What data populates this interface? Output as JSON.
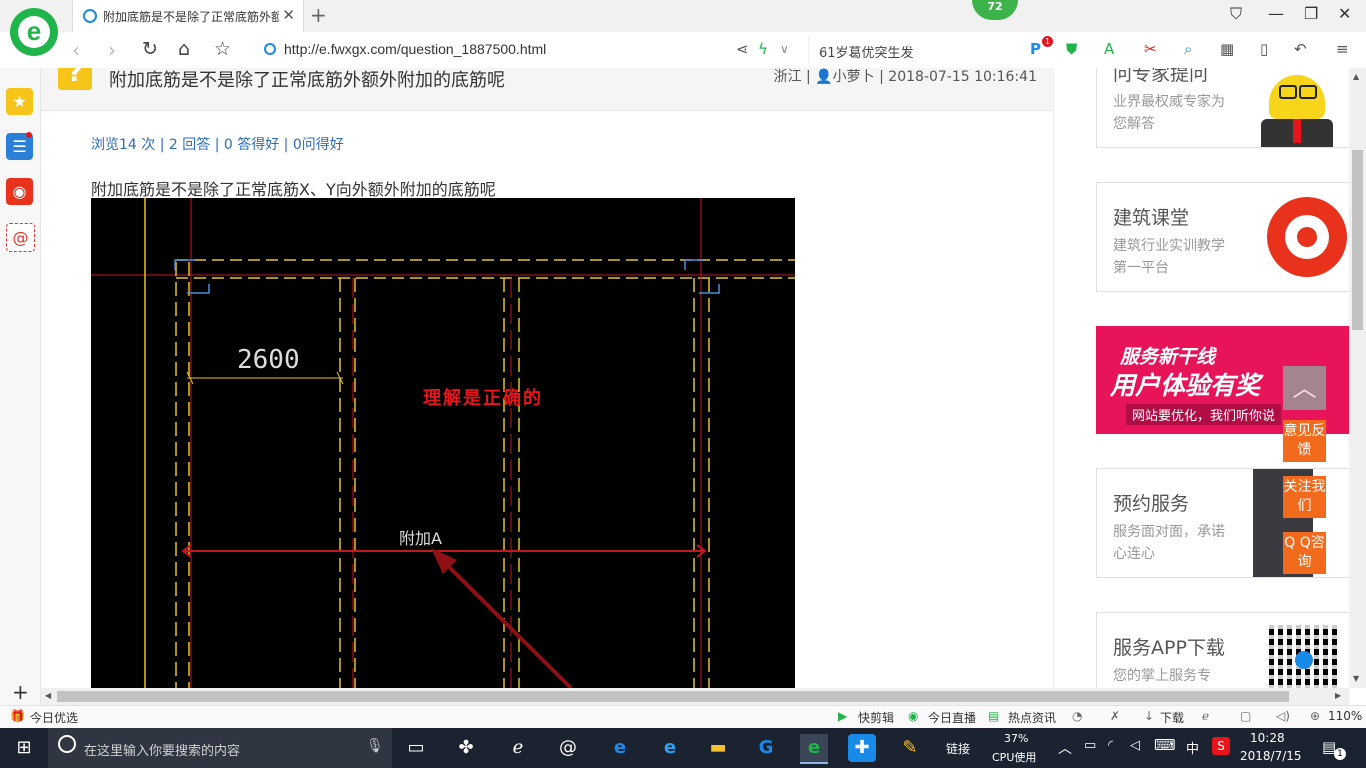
{
  "browser": {
    "tab_title": "附加底筋是不是除了正常底筋外额",
    "badge_count": "72",
    "url": "http://e.fwxgx.com/question_1887500.html",
    "search_text": "61岁葛优突生发",
    "toolbar_badge": "1"
  },
  "question": {
    "title": "附加底筋是不是除了正常底筋外额外附加的底筋呢",
    "location": "浙江",
    "user": "小萝卜",
    "datetime": "2018-07-15 10:16:41",
    "stats": "浏览14 次 | 2 回答 | 0 答得好 | 0问得好",
    "body": "附加底筋是不是除了正常底筋X、Y向外额外附加的底筋呢"
  },
  "cad": {
    "dimension": "2600",
    "note": "理解是正确的",
    "label": "附加A"
  },
  "sidebar_cards": [
    {
      "title": "问专家提问",
      "desc": "业界最权威专家为您解答"
    },
    {
      "title": "建筑课堂",
      "desc": "建筑行业实训教学第一平台"
    },
    {
      "title": "服务新干线",
      "desc": "用户体验有奖",
      "sub": "网站要优化，我们听你说"
    },
    {
      "title": "预约服务",
      "desc": "服务面对面，承诺心连心"
    },
    {
      "title": "服务APP下载",
      "desc": "您的掌上服务专"
    }
  ],
  "float_buttons": [
    "意见反馈",
    "关注我们",
    "Q Q咨询"
  ],
  "statusbar": {
    "left": "今日优选",
    "items": [
      "快剪辑",
      "今日直播",
      "热点资讯",
      "下载"
    ],
    "zoom": "110%"
  },
  "taskbar": {
    "search_placeholder": "在这里输入你要搜索的内容",
    "links": "链接",
    "cpu_percent": "37%",
    "cpu_label": "CPU使用",
    "ime": "中",
    "time": "10:28",
    "date": "2018/7/15",
    "notif_count": "1"
  },
  "colors": {
    "accent_green": "#20b54a",
    "link_blue": "#2a6ebb",
    "float_orange": "#f26b1d",
    "cad_red": "#e8141c",
    "cad_yellow": "#e6c229"
  }
}
